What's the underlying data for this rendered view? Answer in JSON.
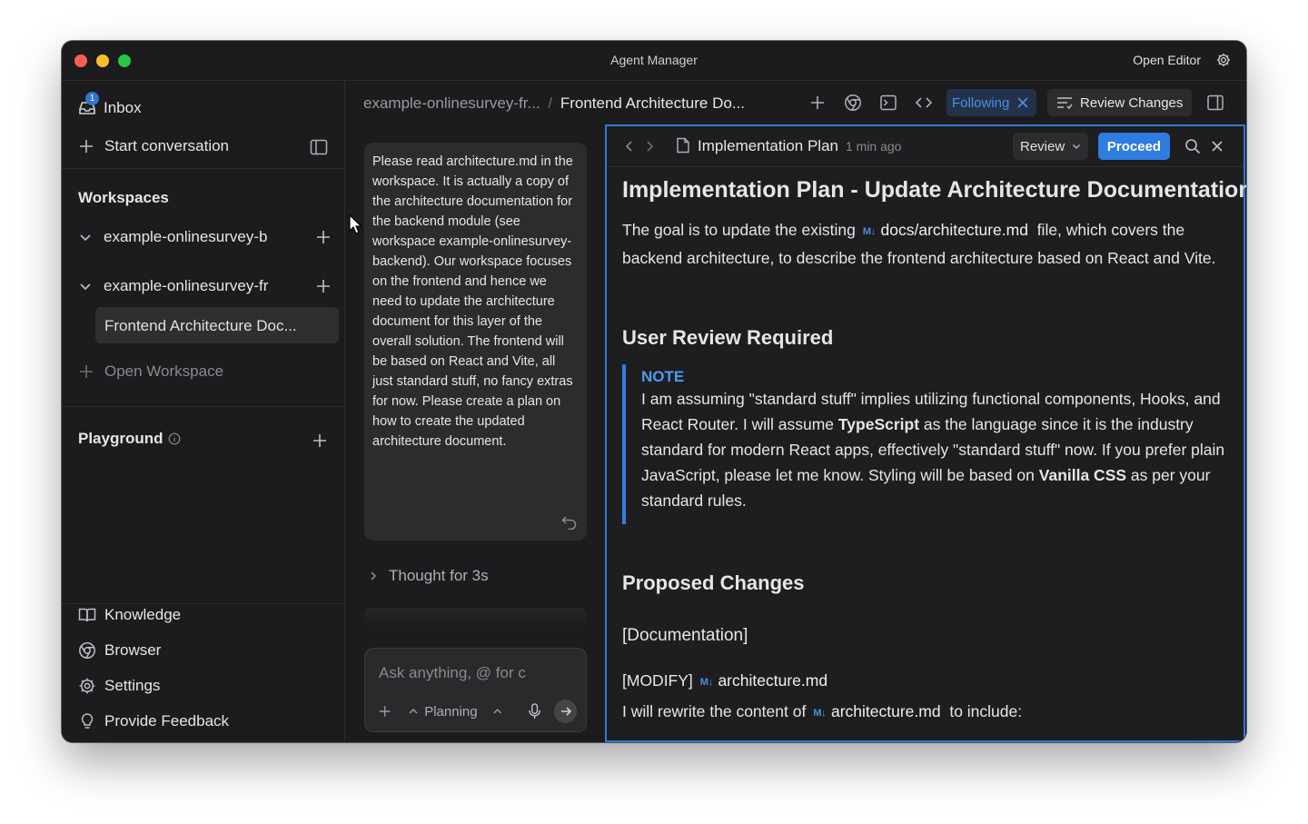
{
  "window": {
    "title": "Agent Manager",
    "open_editor": "Open Editor"
  },
  "sidebar": {
    "inbox": {
      "label": "Inbox",
      "badge": "1"
    },
    "start_conversation": "Start conversation",
    "workspaces_heading": "Workspaces",
    "workspaces": [
      {
        "label": "example-onlinesurvey-b"
      },
      {
        "label": "example-onlinesurvey-fr"
      }
    ],
    "active_conversation": "Frontend Architecture Doc...",
    "open_workspace": "Open Workspace",
    "playground_heading": "Playground",
    "bottom": {
      "knowledge": "Knowledge",
      "browser": "Browser",
      "settings": "Settings",
      "feedback": "Provide Feedback"
    }
  },
  "topbar": {
    "breadcrumb_workspace": "example-onlinesurvey-fr...",
    "breadcrumb_sep": "/",
    "breadcrumb_current": "Frontend Architecture Do...",
    "following": "Following",
    "review_changes": "Review Changes"
  },
  "chat": {
    "user_message": "Please read architecture.md in the workspace. It is actually a copy of the architecture documentation for the backend module (see workspace example-onlinesurvey-backend). Our workspace focuses on the frontend and hence we need to update the architecture document for this layer of the overall solution. The frontend will be based on React and Vite, all just standard stuff, no fancy extras for now. Please create a plan on how to create the updated architecture document.",
    "thought": "Thought for 3s",
    "composer_placeholder": "Ask anything, @ for c",
    "mode": "Planning"
  },
  "doc": {
    "title": "Implementation Plan",
    "time": "1 min ago",
    "review_label": "Review",
    "proceed_label": "Proceed",
    "h1": "Implementation Plan - Update Architecture Documentation",
    "intro_pre": "The goal is to update the existing",
    "md_badge": "M↓",
    "intro_file": "docs/architecture.md",
    "intro_post": "file, which covers the backend architecture, to describe the frontend architecture based on React and Vite.",
    "user_review_heading": "User Review Required",
    "note_label": "NOTE",
    "note_1": "I am assuming \"standard stuff\" implies utilizing functional components, Hooks, and React Router. I will assume",
    "note_ts": "TypeScript",
    "note_2": "as the language since it is the industry standard for modern React apps, effectively \"standard stuff\" now. If you prefer plain JavaScript, please let me know. Styling will be based on",
    "note_css": "Vanilla CSS",
    "note_3": "as per your standard rules.",
    "proposed_heading": "Proposed Changes",
    "documentation_heading": "[Documentation]",
    "modify_label": "[MODIFY]",
    "modify_file": "architecture.md",
    "rewrite_pre": "I will rewrite the content of",
    "rewrite_file": "architecture.md",
    "rewrite_post": "to include:"
  }
}
